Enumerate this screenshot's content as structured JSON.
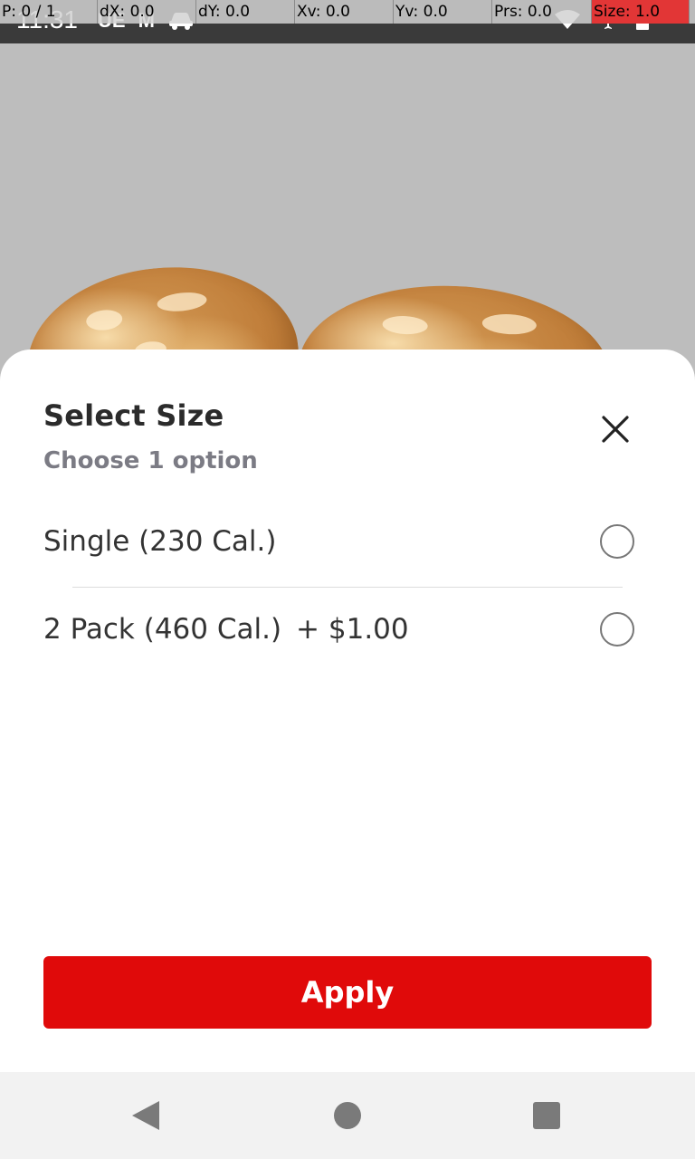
{
  "status_bar": {
    "time": "11:31",
    "left_icons": [
      "UE",
      "M",
      "car-icon"
    ],
    "right_icons": [
      "wifi-icon",
      "airplane-icon",
      "battery-icon"
    ]
  },
  "debug_overlay": {
    "pointer": "P: 0 / 1",
    "dx": "dX: 0.0",
    "dy": "dY: 0.0",
    "xv": "Xv: 0.0",
    "yv": "Yv: 0.0",
    "prs": "Prs: 0.0",
    "size": "Size: 1.0"
  },
  "sheet": {
    "title": "Select Size",
    "subtitle": "Choose 1 option",
    "close_icon": "close-icon",
    "options": [
      {
        "label": "Single (230 Cal.)",
        "price": "",
        "selected": false
      },
      {
        "label": "2 Pack (460 Cal.)",
        "price": "+ $1.00",
        "selected": false
      }
    ],
    "apply_label": "Apply"
  },
  "colors": {
    "accent": "#e00a0a",
    "title_text": "#2b2b2b",
    "subtitle_text": "#7b7b84",
    "overlay_bg": "#bdbdbd"
  },
  "nav_bar": {
    "icons": [
      "back-icon",
      "home-icon",
      "recents-icon"
    ]
  }
}
